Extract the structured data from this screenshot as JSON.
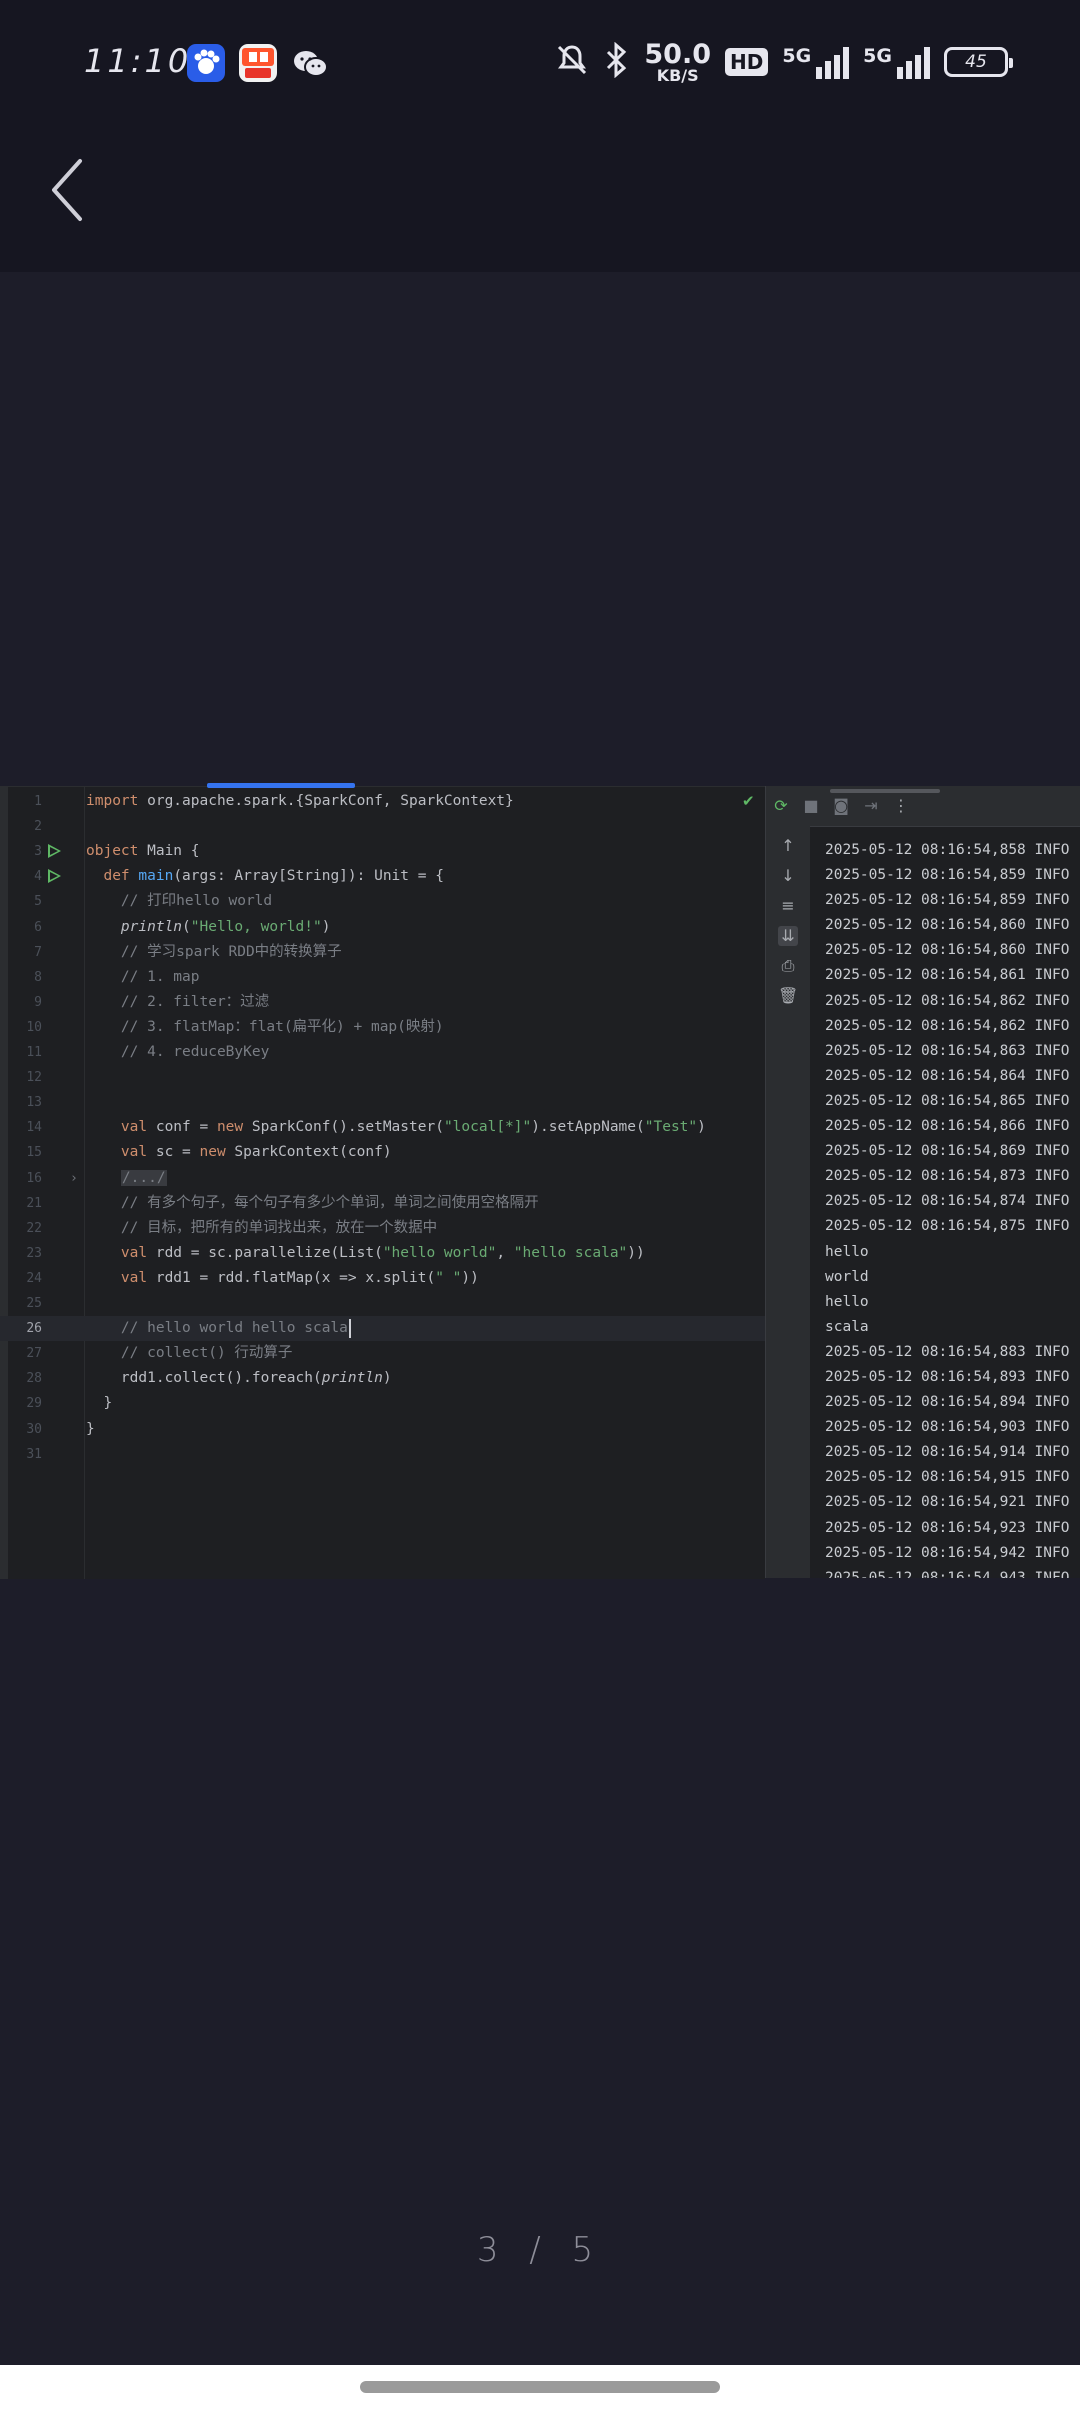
{
  "status_bar": {
    "time": "11:10",
    "net_speed_value": "50.0",
    "net_speed_unit": "KB/S",
    "hd_badge": "HD",
    "sim1_label": "5G",
    "sim2_label": "5G",
    "battery": "45",
    "apps": [
      "baidu-app-icon",
      "58-app-icon",
      "wechat-app-icon"
    ]
  },
  "nav": {
    "back_icon": "chevron-left-icon"
  },
  "editor": {
    "lines": [
      {
        "n": "1",
        "segments": [
          {
            "t": "import ",
            "c": "kw"
          },
          {
            "t": "org.apache.spark.{SparkConf, SparkContext}",
            "c": ""
          }
        ]
      },
      {
        "n": "2",
        "segments": []
      },
      {
        "n": "3",
        "run": true,
        "segments": [
          {
            "t": "object ",
            "c": "kw"
          },
          {
            "t": "Main {",
            "c": ""
          }
        ]
      },
      {
        "n": "4",
        "run": true,
        "segments": [
          {
            "t": "  def ",
            "c": "kw"
          },
          {
            "t": "main",
            "c": "fn"
          },
          {
            "t": "(args: Array[String]): Unit = {",
            "c": ""
          }
        ]
      },
      {
        "n": "5",
        "segments": [
          {
            "t": "    // 打印hello world",
            "c": "cm"
          }
        ]
      },
      {
        "n": "6",
        "segments": [
          {
            "t": "    ",
            "c": ""
          },
          {
            "t": "println",
            "c": "it"
          },
          {
            "t": "(",
            "c": ""
          },
          {
            "t": "\"Hello, world!\"",
            "c": "str"
          },
          {
            "t": ")",
            "c": ""
          }
        ]
      },
      {
        "n": "7",
        "segments": [
          {
            "t": "    // 学习spark RDD中的转换算子",
            "c": "cm"
          }
        ]
      },
      {
        "n": "8",
        "segments": [
          {
            "t": "    // 1. map",
            "c": "cm"
          }
        ]
      },
      {
        "n": "9",
        "segments": [
          {
            "t": "    // 2. filter：过滤",
            "c": "cm"
          }
        ]
      },
      {
        "n": "10",
        "segments": [
          {
            "t": "    // 3. flatMap：flat(扁平化) + map(映射)",
            "c": "cm"
          }
        ]
      },
      {
        "n": "11",
        "segments": [
          {
            "t": "    // 4. reduceByKey",
            "c": "cm"
          }
        ]
      },
      {
        "n": "12",
        "segments": []
      },
      {
        "n": "13",
        "segments": []
      },
      {
        "n": "14",
        "segments": [
          {
            "t": "    val ",
            "c": "kw"
          },
          {
            "t": "conf = ",
            "c": ""
          },
          {
            "t": "new ",
            "c": "kw"
          },
          {
            "t": "SparkConf().setMaster(",
            "c": ""
          },
          {
            "t": "\"local[*]\"",
            "c": "str"
          },
          {
            "t": ").setAppName(",
            "c": ""
          },
          {
            "t": "\"Test\"",
            "c": "str"
          },
          {
            "t": ")",
            "c": ""
          }
        ]
      },
      {
        "n": "15",
        "segments": [
          {
            "t": "    val ",
            "c": "kw"
          },
          {
            "t": "sc = ",
            "c": ""
          },
          {
            "t": "new ",
            "c": "kw"
          },
          {
            "t": "SparkContext(conf)",
            "c": ""
          }
        ]
      },
      {
        "n": "16",
        "fold": true,
        "segments": [
          {
            "t": "    ",
            "c": ""
          },
          {
            "t": "/.../",
            "c": "folded"
          }
        ]
      },
      {
        "n": "21",
        "segments": [
          {
            "t": "    // 有多个句子，每个句子有多少个单词，单词之间使用空格隔开",
            "c": "cm"
          }
        ]
      },
      {
        "n": "22",
        "segments": [
          {
            "t": "    // 目标，把所有的单词找出来，放在一个数据中",
            "c": "cm"
          }
        ]
      },
      {
        "n": "23",
        "segments": [
          {
            "t": "    val ",
            "c": "kw"
          },
          {
            "t": "rdd = sc.parallelize(List(",
            "c": ""
          },
          {
            "t": "\"hello world\"",
            "c": "str"
          },
          {
            "t": ", ",
            "c": ""
          },
          {
            "t": "\"hello scala\"",
            "c": "str"
          },
          {
            "t": "))",
            "c": ""
          }
        ]
      },
      {
        "n": "24",
        "segments": [
          {
            "t": "    val ",
            "c": "kw"
          },
          {
            "t": "rdd1 = rdd.flatMap(x => x.split(",
            "c": ""
          },
          {
            "t": "\" \"",
            "c": "str"
          },
          {
            "t": "))",
            "c": ""
          }
        ]
      },
      {
        "n": "25",
        "segments": []
      },
      {
        "n": "26",
        "current": true,
        "caret": true,
        "segments": [
          {
            "t": "    // hello world hello scala",
            "c": "cm"
          }
        ]
      },
      {
        "n": "27",
        "segments": [
          {
            "t": "    // collect() 行动算子",
            "c": "cm"
          }
        ]
      },
      {
        "n": "28",
        "segments": [
          {
            "t": "    rdd1.collect().foreach(",
            "c": ""
          },
          {
            "t": "println",
            "c": "it"
          },
          {
            "t": ")",
            "c": ""
          }
        ]
      },
      {
        "n": "29",
        "segments": [
          {
            "t": "  }",
            "c": ""
          }
        ]
      },
      {
        "n": "30",
        "segments": [
          {
            "t": "}",
            "c": ""
          }
        ]
      },
      {
        "n": "31",
        "segments": []
      }
    ]
  },
  "console": {
    "toolbar_icons": [
      "rerun-icon",
      "stop-icon",
      "camera-icon",
      "exit-icon",
      "more-icon"
    ],
    "side_icons": [
      "arrow-up-icon",
      "arrow-down-icon",
      "soft-wrap-icon",
      "scroll-to-end-icon",
      "print-icon",
      "trash-icon"
    ],
    "lines": [
      "2025-05-12 08:16:54,858 INFO",
      "2025-05-12 08:16:54,859 INFO",
      "2025-05-12 08:16:54,859 INFO",
      "2025-05-12 08:16:54,860 INFO",
      "2025-05-12 08:16:54,860 INFO",
      "2025-05-12 08:16:54,861 INFO",
      "2025-05-12 08:16:54,862 INFO",
      "2025-05-12 08:16:54,862 INFO",
      "2025-05-12 08:16:54,863 INFO",
      "2025-05-12 08:16:54,864 INFO",
      "2025-05-12 08:16:54,865 INFO",
      "2025-05-12 08:16:54,866 INFO",
      "2025-05-12 08:16:54,869 INFO",
      "2025-05-12 08:16:54,873 INFO",
      "2025-05-12 08:16:54,874 INFO",
      "2025-05-12 08:16:54,875 INFO",
      "hello",
      "world",
      "hello",
      "scala",
      "2025-05-12 08:16:54,883 INFO",
      "2025-05-12 08:16:54,893 INFO",
      "2025-05-12 08:16:54,894 INFO",
      "2025-05-12 08:16:54,903 INFO",
      "2025-05-12 08:16:54,914 INFO",
      "2025-05-12 08:16:54,915 INFO",
      "2025-05-12 08:16:54,921 INFO",
      "2025-05-12 08:16:54,923 INFO",
      "2025-05-12 08:16:54,942 INFO",
      "2025-05-12 08:16:54,943 INFO"
    ]
  },
  "pager": {
    "text": "3 / 5"
  }
}
